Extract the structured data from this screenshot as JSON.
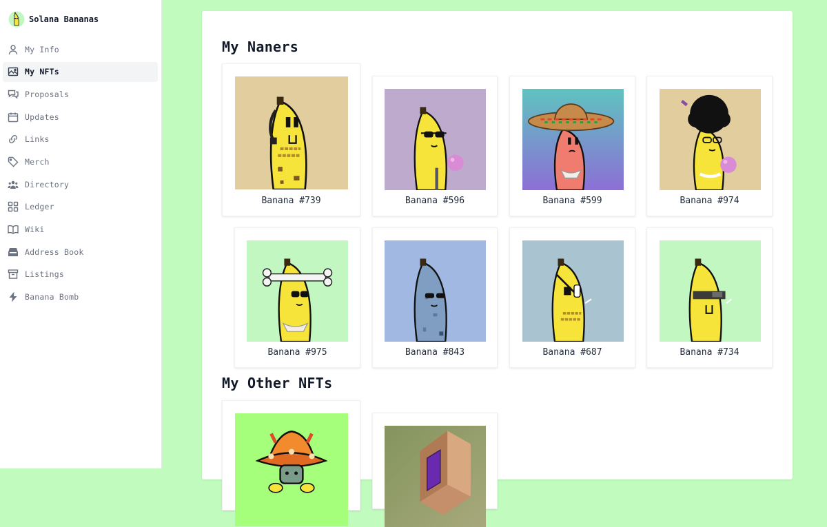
{
  "app": {
    "name": "Solana Bananas",
    "logo_icon": "banana-logo-icon"
  },
  "sidebar": {
    "items": [
      {
        "label": "My Info",
        "icon": "user-icon",
        "active": false
      },
      {
        "label": "My NFTs",
        "icon": "image-icon",
        "active": true
      },
      {
        "label": "Proposals",
        "icon": "chat-bubbles-icon",
        "active": false
      },
      {
        "label": "Updates",
        "icon": "calendar-icon",
        "active": false
      },
      {
        "label": "Links",
        "icon": "link-icon",
        "active": false
      },
      {
        "label": "Merch",
        "icon": "tag-icon",
        "active": false
      },
      {
        "label": "Directory",
        "icon": "users-icon",
        "active": false
      },
      {
        "label": "Ledger",
        "icon": "grid-icon",
        "active": false
      },
      {
        "label": "Wiki",
        "icon": "book-open-icon",
        "active": false
      },
      {
        "label": "Address Book",
        "icon": "inbox-icon",
        "active": false
      },
      {
        "label": "Listings",
        "icon": "archive-icon",
        "active": false
      },
      {
        "label": "Banana Bomb",
        "icon": "lightning-icon",
        "active": false
      }
    ]
  },
  "main": {
    "sections": [
      {
        "title": "My Naners"
      },
      {
        "title": "My Other NFTs"
      }
    ],
    "naners": [
      {
        "label": "Banana #739",
        "bg": "#e2cd9e",
        "accessory": "headset"
      },
      {
        "label": "Banana #596",
        "bg": "#bdaacd",
        "accessory": "bubblegum"
      },
      {
        "label": "Banana #599",
        "bg_gradient": [
          "#5fc3c0",
          "#8c6fd6"
        ],
        "accessory": "sombrero"
      },
      {
        "label": "Banana #974",
        "bg": "#e2cd9e",
        "accessory": "afro"
      },
      {
        "label": "Banana #975",
        "bg": "#c2f7c2",
        "accessory": "bone"
      },
      {
        "label": "Banana #843",
        "bg": "#a0b8e2",
        "accessory": "sunglasses"
      },
      {
        "label": "Banana #687",
        "bg": "#a9c3d1",
        "accessory": "eyepatch"
      },
      {
        "label": "Banana #734",
        "bg": "#c2f7c2",
        "accessory": "visor"
      }
    ],
    "other_nfts": [
      {
        "bg": "#a6ff7b",
        "subject": "mushroom-character"
      },
      {
        "bg_gradient": [
          "#84945e",
          "#a7a97c"
        ],
        "subject": "purple-door-room"
      }
    ]
  },
  "colors": {
    "page_bg": "#c1fcbe",
    "banana_yellow": "#f6e43a",
    "active_nav_bg": "#f3f4f6"
  }
}
